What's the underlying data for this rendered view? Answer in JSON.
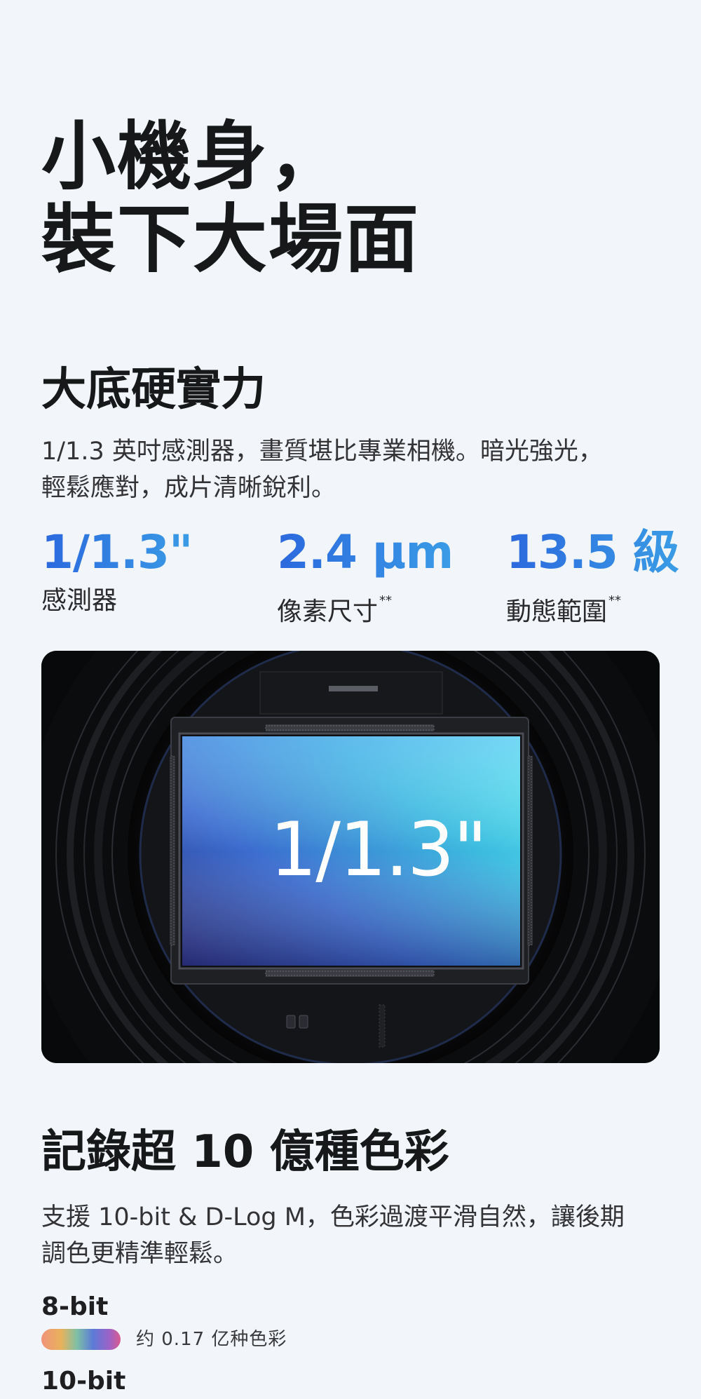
{
  "hero": {
    "title_line1": "小機身，",
    "title_line2": "裝下大場面"
  },
  "sensor_section": {
    "title": "大底硬實力",
    "desc_line1": "1/1.3 英吋感測器，畫質堪比專業相機。暗光強光，",
    "desc_line2": "輕鬆應對，成片清晰銳利。",
    "stats": [
      {
        "value": "1/1.3\"",
        "label": "感測器",
        "footnote": ""
      },
      {
        "value": "2.4 μm",
        "label": "像素尺寸",
        "footnote": "**"
      },
      {
        "value": "13.5 級",
        "label": "動態範圍",
        "footnote": "**"
      }
    ],
    "figure_label": "1/1.3\""
  },
  "color_section": {
    "title": "記錄超 10 億種色彩",
    "desc_line1": "支援 10-bit & D-Log M，色彩過渡平滑自然，讓後期",
    "desc_line2": "調色更精準輕鬆。",
    "bits": [
      {
        "label": "8-bit",
        "caption": "约 0.17 亿种色彩"
      },
      {
        "label": "10-bit",
        "caption": ""
      }
    ]
  },
  "colors": {
    "background": "#f2f6fa",
    "accent_start": "#2b68de",
    "accent_end": "#3a9ce6",
    "title": "#17181a"
  }
}
